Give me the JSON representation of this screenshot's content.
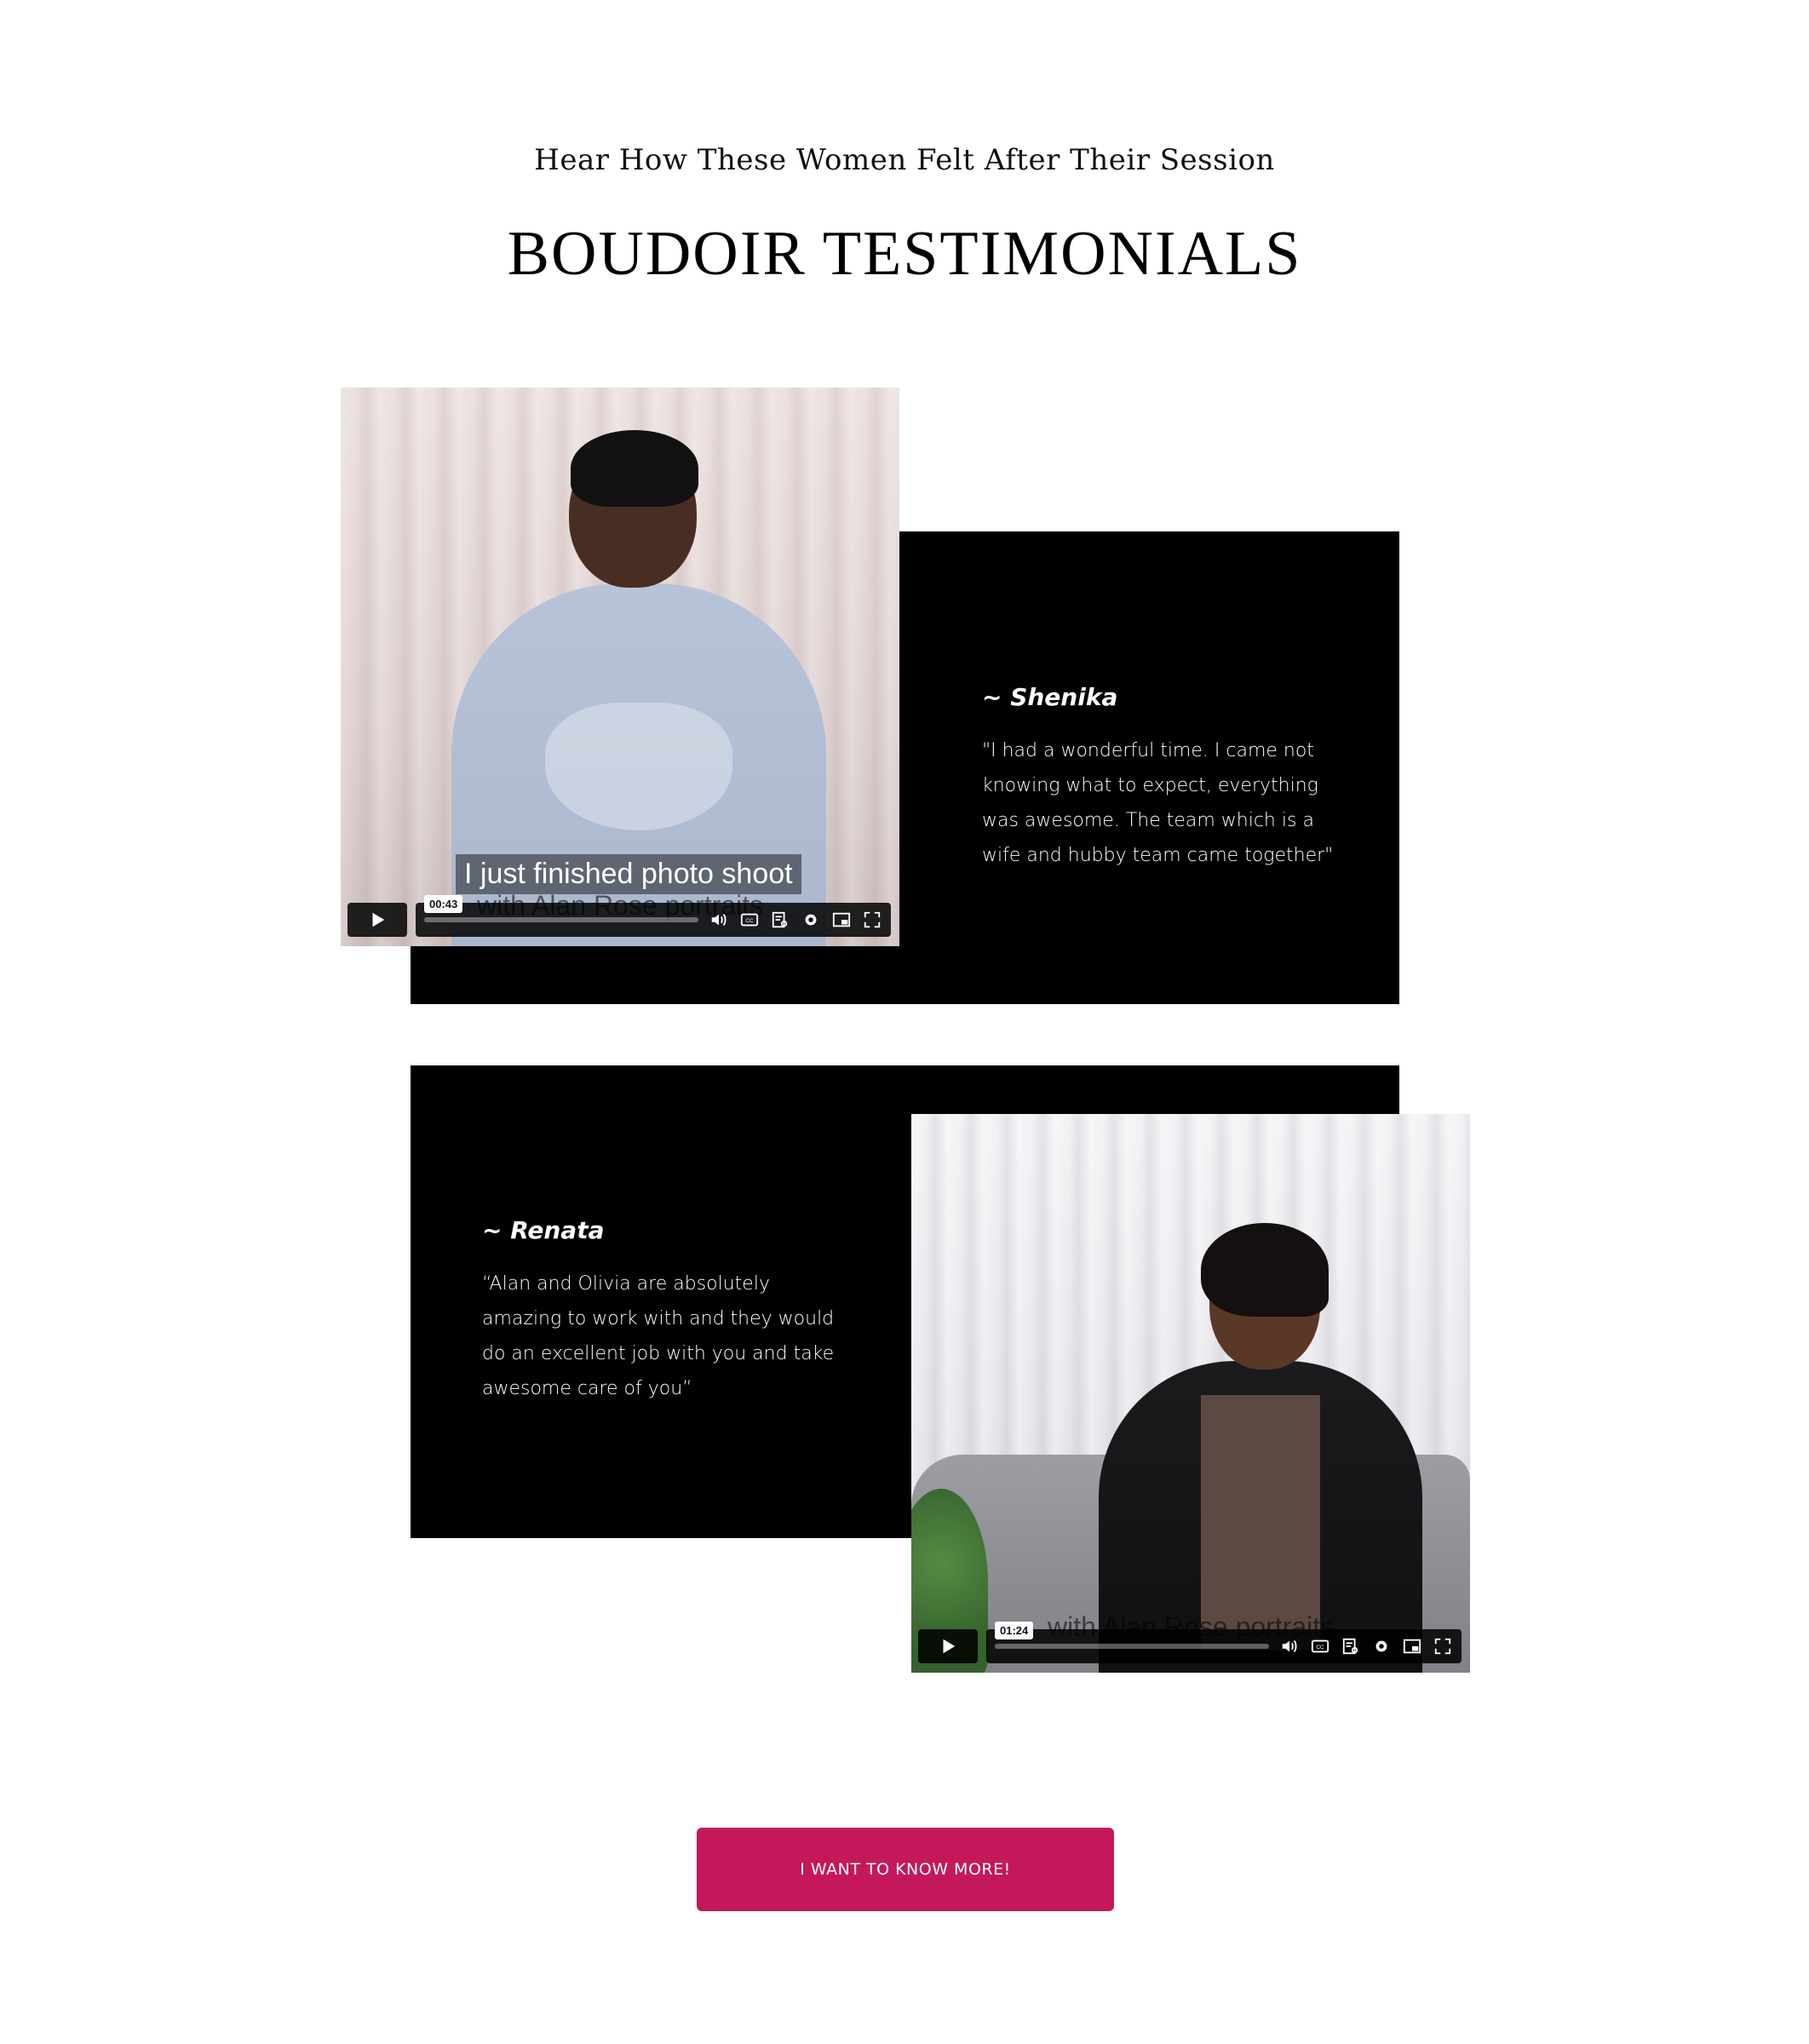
{
  "header": {
    "subheading": "Hear How These Women Felt After Their Session",
    "title": "BOUDOIR TESTIMONIALS"
  },
  "testimonials": [
    {
      "name": "~ Shenika",
      "quote": "\"I had a wonderful time. I came not knowing what to expect, everything was awesome. The team which is a wife and hubby team came together\"",
      "video": {
        "caption_line1": "I just finished photo shoot",
        "caption_line2": "with Alan Rose portraits",
        "time": "00:43",
        "progress": 0
      }
    },
    {
      "name": "~ Renata",
      "quote": "“Alan and Olivia are absolutely amazing to work with and they would do an excellent job with you and take awesome care of you”",
      "video": {
        "caption_line1": "",
        "caption_line2": "with Alan Rose portraits",
        "time": "01:24",
        "progress": 0
      }
    }
  ],
  "cta": {
    "label": "I WANT TO KNOW MORE!"
  },
  "colors": {
    "panel": "#000000",
    "cta": "#c4185a",
    "text_on_dark": "#ffffff"
  },
  "icons": [
    "play-icon",
    "volume-icon",
    "captions-icon",
    "transcript-icon",
    "settings-icon",
    "picture-in-picture-icon",
    "fullscreen-icon"
  ]
}
